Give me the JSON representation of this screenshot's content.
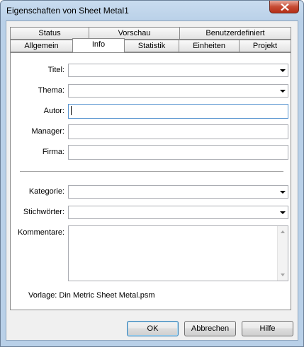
{
  "window": {
    "title": "Eigenschaften von Sheet Metal1"
  },
  "tabs_back": [
    {
      "label": "Status"
    },
    {
      "label": "Vorschau"
    },
    {
      "label": "Benutzerdefiniert"
    }
  ],
  "tabs_front": [
    {
      "label": "Allgemein"
    },
    {
      "label": "Info",
      "active": true
    },
    {
      "label": "Statistik"
    },
    {
      "label": "Einheiten"
    },
    {
      "label": "Projekt"
    }
  ],
  "fields": {
    "titel": {
      "label": "Titel:",
      "value": ""
    },
    "thema": {
      "label": "Thema:",
      "value": ""
    },
    "autor": {
      "label": "Autor:",
      "value": ""
    },
    "manager": {
      "label": "Manager:",
      "value": ""
    },
    "firma": {
      "label": "Firma:",
      "value": ""
    },
    "kategorie": {
      "label": "Kategorie:",
      "value": ""
    },
    "stichwoerter": {
      "label": "Stichwörter:",
      "value": ""
    },
    "kommentare": {
      "label": "Kommentare:",
      "value": ""
    }
  },
  "template_info": "Vorlage: Din Metric Sheet Metal.psm",
  "buttons": {
    "ok": "OK",
    "cancel": "Abbrechen",
    "help": "Hilfe"
  },
  "colors": {
    "highlight": "#e0201c",
    "close_button": "#c64b34"
  },
  "icons": {
    "close": "close-icon"
  }
}
